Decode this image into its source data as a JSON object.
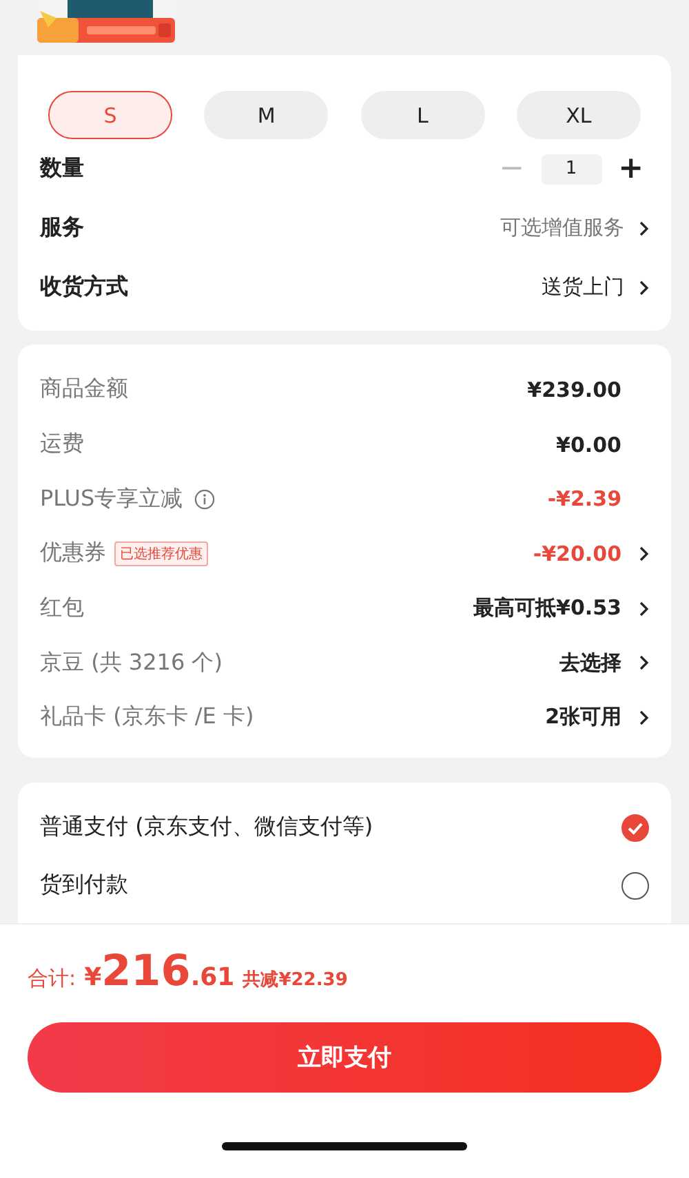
{
  "sizes": [
    {
      "label": "S",
      "selected": true
    },
    {
      "label": "M",
      "selected": false
    },
    {
      "label": "L",
      "selected": false
    },
    {
      "label": "XL",
      "selected": false
    }
  ],
  "quantity": {
    "label": "数量",
    "minus": "−",
    "value": "1",
    "plus": "+",
    "minus_disabled": true
  },
  "options": [
    {
      "label": "服务",
      "value": "可选增值服务",
      "muted": true
    },
    {
      "label": "收货方式",
      "value": "送货上门",
      "muted": false
    }
  ],
  "price_rows": [
    {
      "label": "商品金额",
      "value": "¥239.00",
      "discount": false,
      "arrow": false
    },
    {
      "label": "运费",
      "value": "¥0.00",
      "discount": false,
      "arrow": false
    },
    {
      "label": "PLUS专享立减",
      "info": true,
      "value": "-¥2.39",
      "discount": true,
      "arrow": false
    },
    {
      "label": "优惠券",
      "tag": "已选推荐优惠",
      "value": "-¥20.00",
      "discount": true,
      "arrow": true
    },
    {
      "label": "红包",
      "value": "最高可抵¥0.53",
      "discount": false,
      "arrow": true
    },
    {
      "label": "京豆 (共 3216 个)",
      "value": "去选择",
      "discount": false,
      "arrow": true
    },
    {
      "label": "礼品卡 (京东卡 /E 卡)",
      "value": "2张可用",
      "discount": false,
      "arrow": true
    }
  ],
  "payment_methods": [
    {
      "label": "普通支付 (京东支付、微信支付等)",
      "selected": true
    },
    {
      "label": "货到付款",
      "selected": false
    }
  ],
  "total": {
    "label": "合计:",
    "currency": "¥",
    "integer": "216",
    "decimal": ".61",
    "saving": "共减¥22.39"
  },
  "pay_button": "立即支付"
}
